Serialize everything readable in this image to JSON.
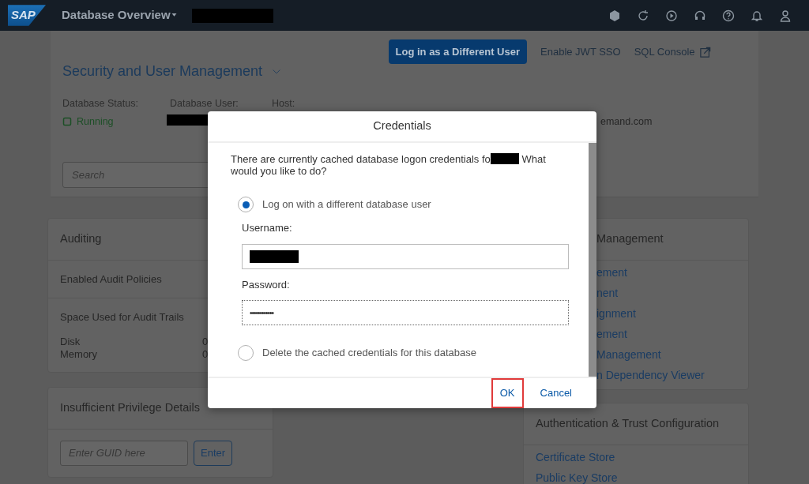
{
  "shell_bar": {
    "logo": "SAP",
    "title": "Database Overview"
  },
  "header": {
    "actions": [
      {
        "label": "Log in as a Different User",
        "kind": "primary"
      },
      {
        "label": "Enable JWT SSO",
        "kind": "link"
      },
      {
        "label": "SQL Console",
        "kind": "external"
      }
    ],
    "title": "Security and User Management",
    "info": [
      {
        "label": "Database Status:",
        "value": "Running",
        "kind": "status"
      },
      {
        "label": "Database User:",
        "kind": "redacted"
      },
      {
        "label": "Host:",
        "value": "emand.com",
        "kind": "text"
      }
    ],
    "search": {
      "placeholder": "Search"
    }
  },
  "left_cards": [
    {
      "title": "Auditing",
      "sections": [
        {
          "label": "Enabled Audit Policies"
        },
        {
          "label": "Space Used for Audit Trails",
          "rows": [
            {
              "label": "Disk",
              "value": "0"
            },
            {
              "label": "Memory",
              "value": "0"
            }
          ]
        }
      ]
    },
    {
      "title": "Insufficient Privilege Details",
      "input": {
        "placeholder": "Enter GUID here"
      },
      "button": "Enter"
    }
  ],
  "right_cards": [
    {
      "title": "Management",
      "links": [
        "ement",
        "nent",
        "ignment",
        "ement",
        "Management",
        "n Dependency Viewer"
      ]
    },
    {
      "title": "Authentication & Trust Configuration",
      "links": [
        "Certificate Store",
        "Public Key Store"
      ]
    }
  ],
  "dialog": {
    "title": "Credentials",
    "message_before": "There are currently cached database logon credentials fo",
    "message_after": "What would you like to do?",
    "options": [
      {
        "label": "Log on with a different database user",
        "selected": true
      },
      {
        "label": "Delete the cached credentials for this database",
        "selected": false
      }
    ],
    "username": {
      "label": "Username:"
    },
    "password": {
      "label": "Password:",
      "value": "••••••••••••"
    },
    "buttons": [
      {
        "label": "OK",
        "highlighted": true
      },
      {
        "label": "Cancel",
        "highlighted": false
      }
    ]
  }
}
